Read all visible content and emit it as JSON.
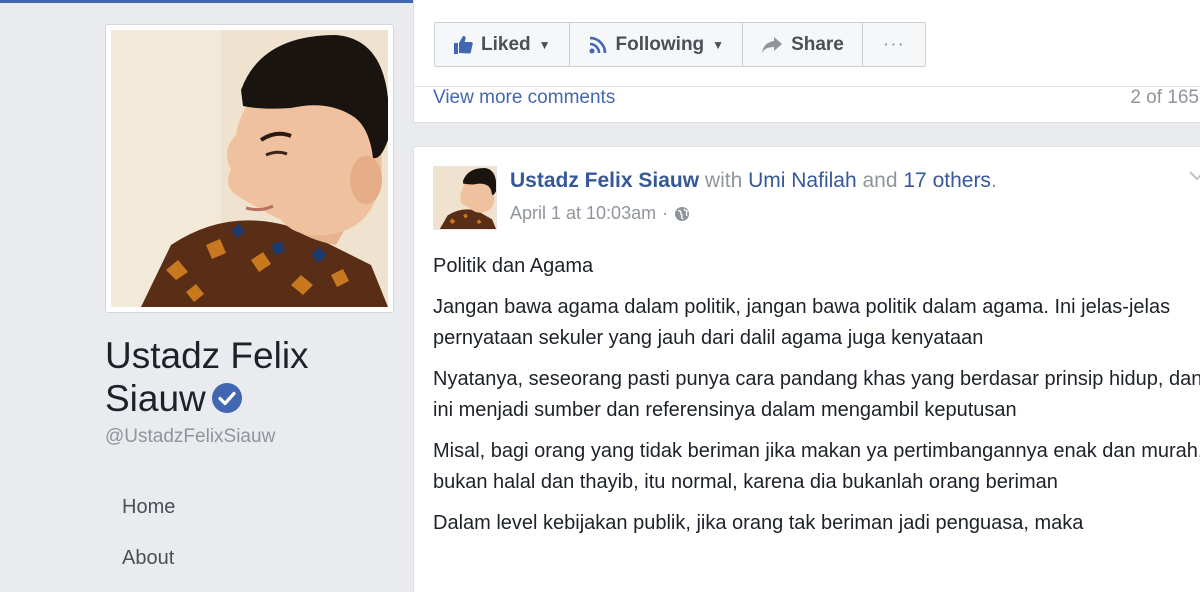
{
  "page": {
    "name_line1": "Ustadz Felix",
    "name_line2": "Siauw",
    "handle": "@UstadzFelixSiauw"
  },
  "nav": {
    "items": [
      {
        "label": "Home"
      },
      {
        "label": "About"
      }
    ]
  },
  "actions": {
    "liked": "Liked",
    "following": "Following",
    "share": "Share",
    "more": "···"
  },
  "comments": {
    "view_more": "View more comments",
    "count": "2 of 165"
  },
  "post": {
    "author": "Ustadz Felix Siauw",
    "with_text": "with",
    "tagged_person": "Umi Nafilah",
    "and_text": "and",
    "others": "17 others",
    "period": ".",
    "timestamp": "April 1 at 10:03am",
    "separator": "·",
    "paragraphs": [
      "Politik dan Agama",
      "Jangan bawa agama dalam politik, jangan bawa politik dalam agama. Ini jelas-jelas pernyataan sekuler yang jauh dari dalil agama juga kenyataan",
      "Nyatanya, seseorang pasti punya cara pandang khas yang berdasar prinsip hidup, dan ini menjadi sumber dan referensinya dalam mengambil keputusan",
      "Misal, bagi orang yang tidak beriman jika makan ya pertimbangannya enak dan murah, bukan halal dan thayib, itu normal, karena dia bukanlah orang beriman",
      "Dalam level kebijakan publik, jika orang tak beriman jadi penguasa, maka"
    ]
  },
  "colors": {
    "link": "#365899",
    "accent": "#4267b2",
    "muted": "#90949c",
    "verified": "#4267b2"
  }
}
